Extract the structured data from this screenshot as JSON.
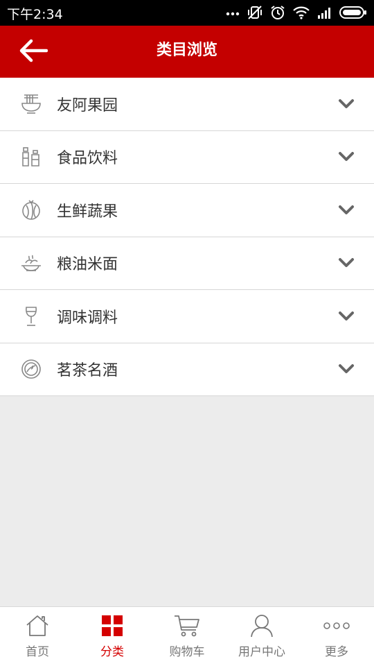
{
  "status_bar": {
    "time": "下午2:34"
  },
  "header": {
    "title": "类目浏览"
  },
  "categories": [
    {
      "label": "友阿果园",
      "icon": "noodle-bowl-icon"
    },
    {
      "label": "食品饮料",
      "icon": "bottles-icon"
    },
    {
      "label": "生鲜蔬果",
      "icon": "watermelon-icon"
    },
    {
      "label": "粮油米面",
      "icon": "dish-icon"
    },
    {
      "label": "调味调料",
      "icon": "wine-glass-icon"
    },
    {
      "label": "茗茶名酒",
      "icon": "plate-icon"
    }
  ],
  "tabs": [
    {
      "label": "首页",
      "icon": "home-icon"
    },
    {
      "label": "分类",
      "icon": "grid-icon",
      "active": true
    },
    {
      "label": "购物车",
      "icon": "cart-icon"
    },
    {
      "label": "用户中心",
      "icon": "user-icon"
    },
    {
      "label": "更多",
      "icon": "more-icon"
    }
  ],
  "colors": {
    "accent": "#c40000",
    "tab_active": "#d40000",
    "icon_gray": "#888888"
  }
}
